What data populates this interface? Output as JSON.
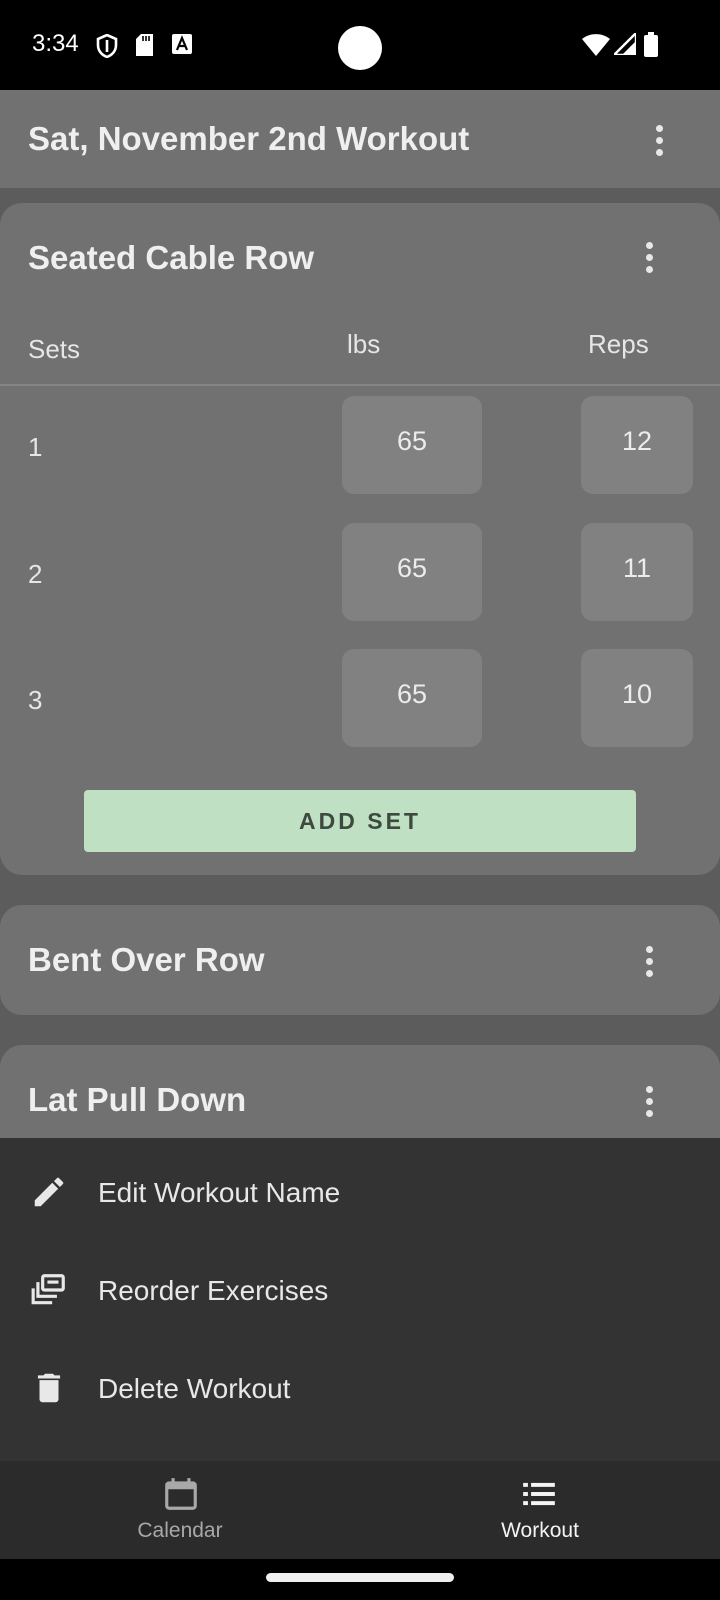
{
  "status_bar": {
    "time": "3:34",
    "icons": [
      "shield-icon",
      "sd-card-icon",
      "keyboard-a-icon",
      "wifi-icon",
      "signal-icon",
      "battery-icon"
    ]
  },
  "app_bar": {
    "title": "Sat, November 2nd Workout",
    "menu_icon": "more-vert-icon"
  },
  "exercises": [
    {
      "name": "Seated Cable Row",
      "expanded": true,
      "headers": {
        "sets": "Sets",
        "lbs": "lbs",
        "reps": "Reps"
      },
      "sets": [
        {
          "set": "1",
          "lbs": "65",
          "reps": "12"
        },
        {
          "set": "2",
          "lbs": "65",
          "reps": "11"
        },
        {
          "set": "3",
          "lbs": "65",
          "reps": "10"
        }
      ],
      "add_set_label": "ADD SET"
    },
    {
      "name": "Bent Over Row",
      "expanded": false
    },
    {
      "name": "Lat Pull Down",
      "expanded": false
    }
  ],
  "bottom_sheet": {
    "items": [
      {
        "label": "Edit Workout Name",
        "icon": "pencil-icon"
      },
      {
        "label": "Reorder Exercises",
        "icon": "reorder-icon"
      },
      {
        "label": "Delete Workout",
        "icon": "trash-icon"
      }
    ]
  },
  "bottom_nav": {
    "items": [
      {
        "label": "Calendar",
        "icon": "calendar-icon",
        "active": false
      },
      {
        "label": "Workout",
        "icon": "list-icon",
        "active": true
      }
    ]
  },
  "colors": {
    "app_bar": "#717171",
    "card": "#717171",
    "background": "#5c5c5c",
    "input_cell": "#818181",
    "add_set_button": "#c0e0c4",
    "sheet": "#333333",
    "bottom_nav": "#2b2b2b"
  }
}
